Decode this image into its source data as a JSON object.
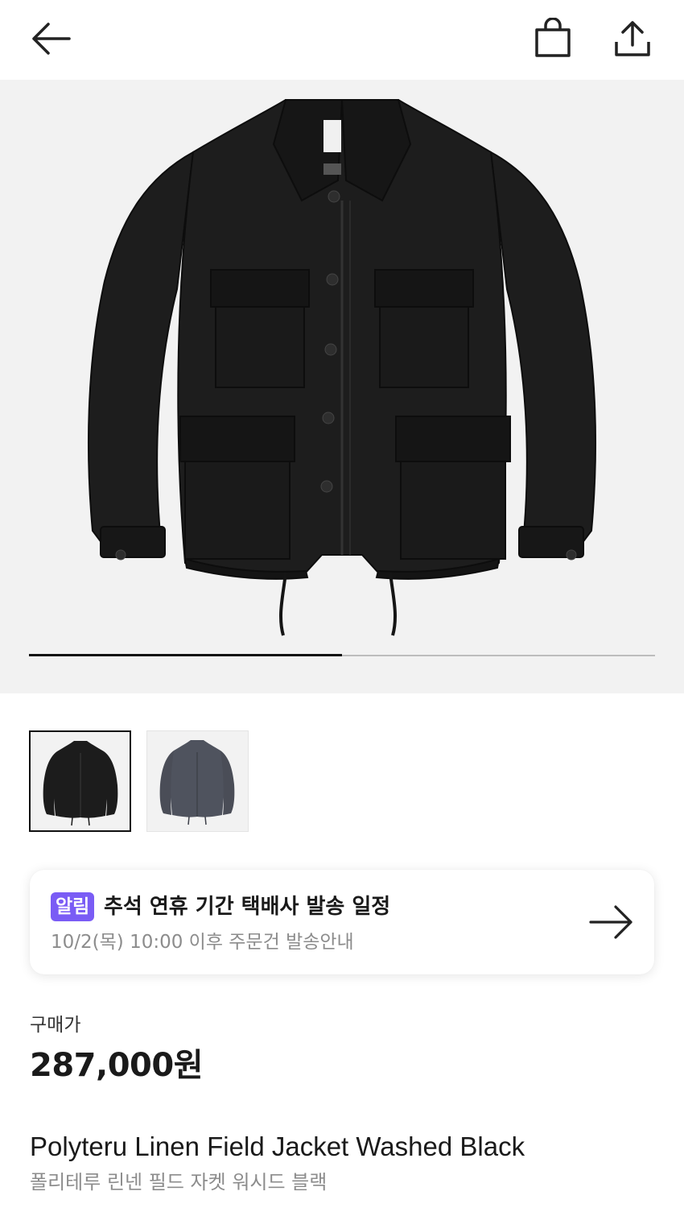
{
  "header": {
    "back_icon": "arrow-left-icon",
    "bag_icon": "shopping-bag-icon",
    "share_icon": "share-upload-icon"
  },
  "gallery": {
    "image_count": 2,
    "current_index": 1,
    "progress_fraction": 0.5,
    "progress_color": "#111111",
    "track_color": "#bdbdbd",
    "background": "#f2f2f2"
  },
  "thumbnails": [
    {
      "name": "thumbnail-black-jacket",
      "selected": true,
      "color": "#1c1c1c"
    },
    {
      "name": "thumbnail-charcoal-jacket",
      "selected": false,
      "color": "#4a4d57"
    }
  ],
  "notice": {
    "badge": "알림",
    "badge_color": "#7a5cf5",
    "title": "추석 연휴 기간 택배사 발송 일정",
    "subtitle": "10/2(목) 10:00 이후 주문건 발송안내",
    "arrow_icon": "arrow-right-icon"
  },
  "price": {
    "label": "구매가",
    "value": "287,000원"
  },
  "product": {
    "name_en": "Polyteru Linen Field Jacket Washed Black",
    "name_ko": "폴리테루 린넨 필드 자켓 워시드 블랙"
  }
}
